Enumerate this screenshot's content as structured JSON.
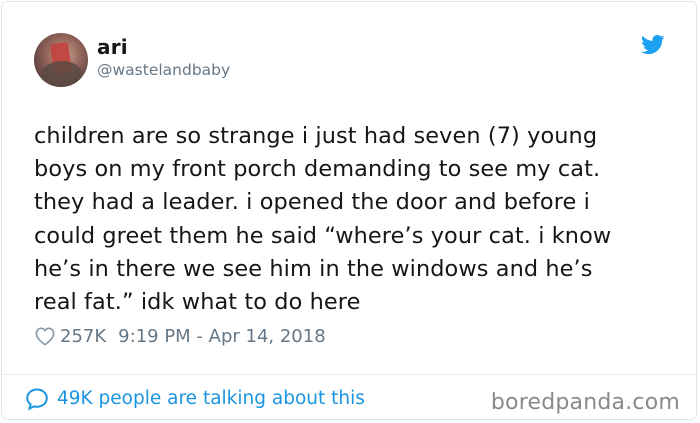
{
  "user": {
    "name": "ari",
    "handle": "@wastelandbaby"
  },
  "tweet": {
    "text": "children are so strange i just had seven (7) young\nboys on my front porch demanding to see my cat.\nthey had a leader. i opened the door and before i\ncould greet them he said “where’s your cat. i know\nhe’s in there we see him in the windows and he’s\nreal fat.” idk what to do here",
    "likes": "257K",
    "timestamp": "9:19 PM - Apr 14, 2018"
  },
  "footer": {
    "talking_label": "49K people are talking about this"
  },
  "watermark": {
    "text": "boredpanda.com"
  },
  "icons": {
    "platform": "twitter-bird-icon",
    "like": "heart-icon",
    "reply": "speech-bubble-icon"
  },
  "colors": {
    "twitter_blue": "#1da1f2",
    "link_blue": "#1b95e0",
    "muted_text": "#657786",
    "primary_text": "#14171a"
  }
}
